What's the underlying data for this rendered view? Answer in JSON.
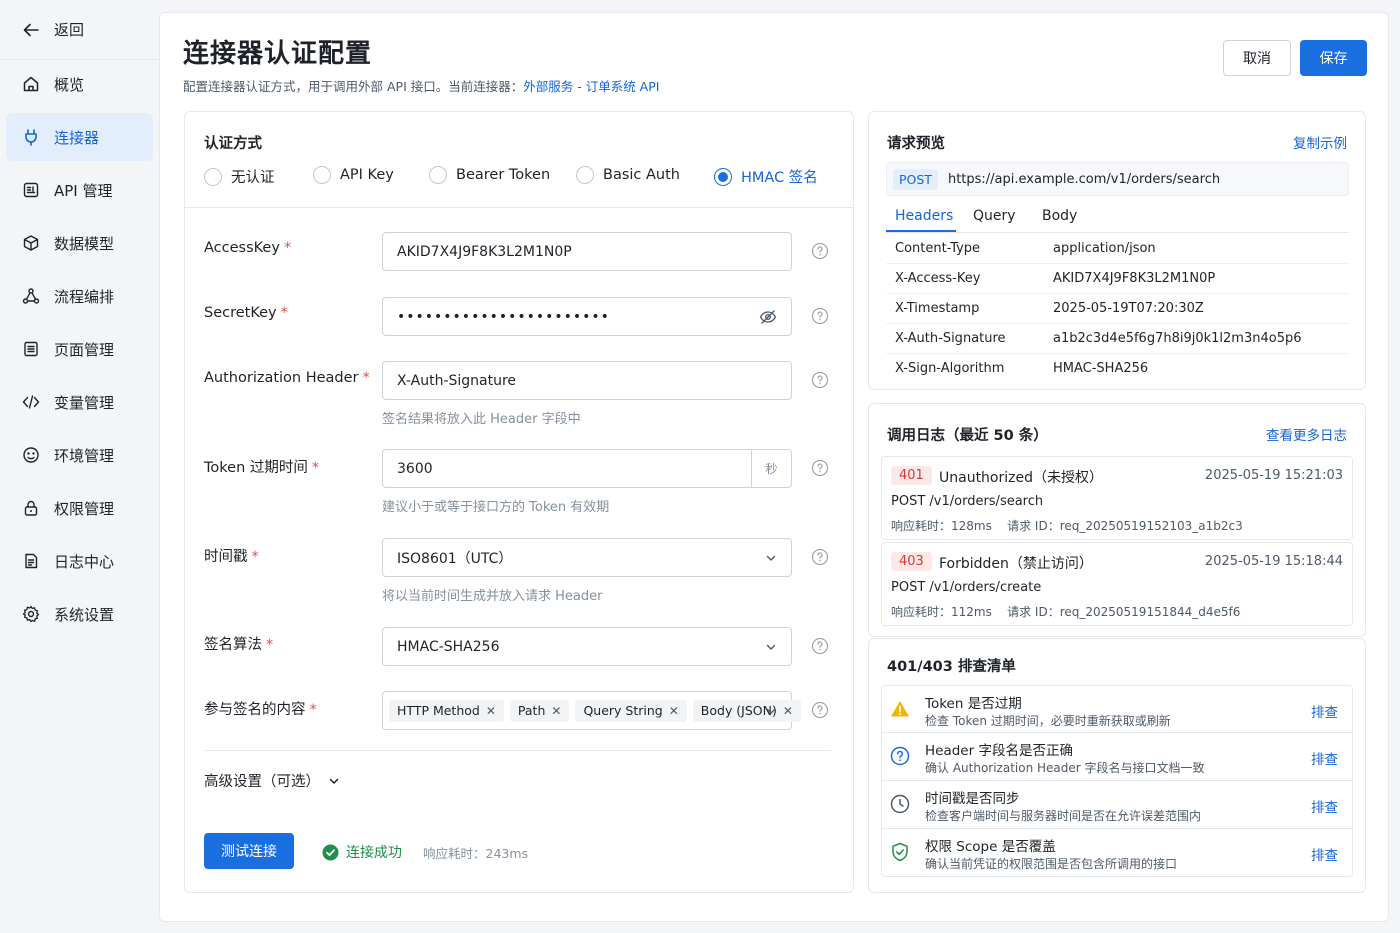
{
  "sidebar": {
    "back_label": "返回",
    "items": [
      {
        "label": "概览",
        "icon": "home-icon"
      },
      {
        "label": "连接器",
        "icon": "plug-icon"
      },
      {
        "label": "API 管理",
        "icon": "api-icon"
      },
      {
        "label": "数据模型",
        "icon": "cube-icon"
      },
      {
        "label": "流程编排",
        "icon": "flow-icon"
      },
      {
        "label": "页面管理",
        "icon": "page-icon"
      },
      {
        "label": "变量管理",
        "icon": "code-icon"
      },
      {
        "label": "环境管理",
        "icon": "environment-icon"
      },
      {
        "label": "权限管理",
        "icon": "lock-icon"
      },
      {
        "label": "日志中心",
        "icon": "log-icon"
      },
      {
        "label": "系统设置",
        "icon": "gear-icon"
      }
    ],
    "active_index": 1
  },
  "header": {
    "title": "连接器认证配置",
    "description": "配置连接器认证方式，用于调用外部 API 接口。当前连接器：",
    "connector_link": "外部服务 - 订单系统 API",
    "cancel_label": "取消",
    "save_label": "保存"
  },
  "auth": {
    "section_title": "认证方式",
    "options": [
      "无认证",
      "API Key",
      "Bearer Token",
      "Basic Auth",
      "HMAC 签名"
    ],
    "selected_index": 4
  },
  "form": {
    "access_key_label": "AccessKey",
    "access_key_value": "AKID7X4J9F8K3L2M1N0P",
    "secret_key_label": "SecretKey",
    "secret_key_value": "•••••••••••••••••••••••",
    "auth_header_label": "Authorization Header",
    "auth_header_value": "X-Auth-Signature",
    "auth_header_hint": "签名结果将放入此 Header 字段中",
    "token_expiry_label": "Token 过期时间",
    "token_expiry_value": "3600",
    "token_expiry_unit": "秒",
    "token_expiry_hint": "建议小于或等于接口方的 Token 有效期",
    "timestamp_label": "时间戳",
    "timestamp_value": "ISO8601（UTC）",
    "timestamp_hint": "将以当前时间生成并放入请求 Header",
    "algorithm_label": "签名算法",
    "algorithm_value": "HMAC-SHA256",
    "sign_content_label": "参与签名的内容",
    "sign_content_tags": [
      "HTTP Method",
      "Path",
      "Query String",
      "Body (JSON)"
    ],
    "required_mark": "*",
    "advanced_label": "高级设置（可选）",
    "test_button": "测试连接",
    "test_status": "连接成功",
    "test_latency": "响应耗时：243ms"
  },
  "preview": {
    "title": "请求预览",
    "copy_link": "复制示例",
    "method": "POST",
    "url": "https://api.example.com/v1/orders/search",
    "tabs": [
      "Headers",
      "Query",
      "Body"
    ],
    "active_tab": 0,
    "headers": [
      {
        "key": "Content-Type",
        "value": "application/json"
      },
      {
        "key": "X-Access-Key",
        "value": "AKID7X4J9F8K3L2M1N0P"
      },
      {
        "key": "X-Timestamp",
        "value": "2025-05-19T07:20:30Z"
      },
      {
        "key": "X-Auth-Signature",
        "value": "a1b2c3d4e5f6g7h8i9j0k1l2m3n4o5p6"
      },
      {
        "key": "X-Sign-Algorithm",
        "value": "HMAC-SHA256"
      }
    ]
  },
  "logs": {
    "title": "调用日志（最近 50 条）",
    "more_link": "查看更多日志",
    "entries": [
      {
        "code": "401",
        "status": "Unauthorized（未授权）",
        "time": "2025-05-19 15:21:03",
        "path": "POST /v1/orders/search",
        "meta": "响应耗时：128ms    请求 ID：req_20250519152103_a1b2c3"
      },
      {
        "code": "403",
        "status": "Forbidden（禁止访问）",
        "time": "2025-05-19 15:18:44",
        "path": "POST /v1/orders/create",
        "meta": "响应耗时：112ms    请求 ID：req_20250519151844_d4e5f6"
      }
    ]
  },
  "checklist": {
    "title": "401/403 排查清单",
    "items": [
      {
        "title": "Token 是否过期",
        "desc": "检查 Token 过期时间，必要时重新获取或刷新",
        "action": "排查",
        "icon": "warning-icon"
      },
      {
        "title": "Header 字段名是否正确",
        "desc": "确认 Authorization Header 字段名与接口文档一致",
        "action": "排查",
        "icon": "question-icon"
      },
      {
        "title": "时间戳是否同步",
        "desc": "检查客户端时间与服务器时间是否在允许误差范围内",
        "action": "排查",
        "icon": "clock-icon"
      },
      {
        "title": "权限 Scope 是否覆盖",
        "desc": "确认当前凭证的权限范围是否包含所调用的接口",
        "action": "排查",
        "icon": "shield-check-icon"
      }
    ]
  },
  "colors": {
    "accent": "#1a6fe0",
    "success": "#1f8f4a",
    "error": "#d93838",
    "warning": "#f5b400"
  }
}
